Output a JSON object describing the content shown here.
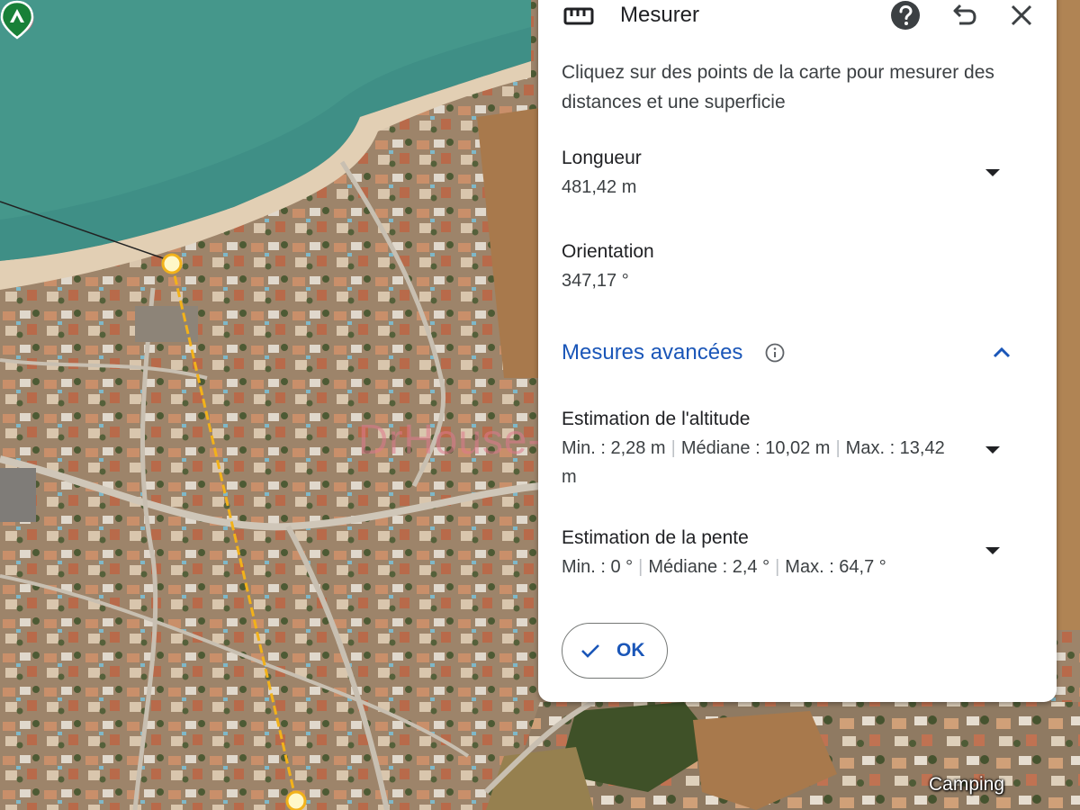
{
  "panel": {
    "title": "Mesurer",
    "title_icon": "ruler-icon",
    "help_icon": "help-icon",
    "undo_icon": "undo-icon",
    "close_icon": "close-icon",
    "instructions": "Cliquez sur des points de la carte pour mesurer des distances et une superficie"
  },
  "length": {
    "label": "Longueur",
    "value": "481,42 m"
  },
  "orientation": {
    "label": "Orientation",
    "value": "347,17 °"
  },
  "advanced": {
    "label": "Mesures avancées",
    "info_icon": "info-icon",
    "toggle_icon": "chevron-up-icon"
  },
  "altitude": {
    "label": "Estimation de l'altitude",
    "min": "Min. : 2,28 m",
    "median": "Médiane : 10,02 m",
    "max": "Max. : 13,42 m",
    "separator": "|"
  },
  "slope": {
    "label": "Estimation de la pente",
    "min": "Min. : 0 °",
    "median": "Médiane : 2,4 °",
    "max": "Max. : 64,7 °",
    "separator": "|"
  },
  "ok_button": {
    "label": "OK",
    "icon": "check-icon"
  },
  "map": {
    "watermark": "DrHouse-Immo",
    "poi_label": "Camping",
    "poi_icon": "camping-pin-icon",
    "colors": {
      "sea": "#3f8f86",
      "beach": "#e2cfb4",
      "town": "#9c8268",
      "fields": "#a8794c",
      "vegetation": "#4e5a30",
      "measure_line": "#f2b21a",
      "accent": "#1a56b8"
    }
  }
}
